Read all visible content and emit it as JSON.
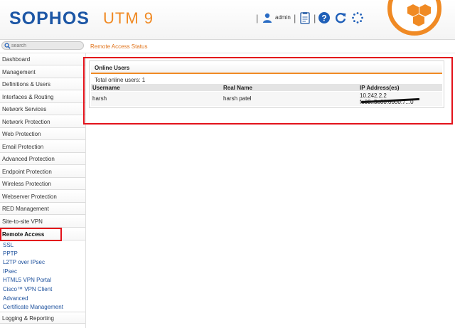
{
  "header": {
    "logo": "SOPHOS",
    "product": "UTM 9",
    "separator": "|",
    "user": "admin"
  },
  "search": {
    "placeholder": "search"
  },
  "breadcrumb": "Remote Access Status",
  "sidebar": {
    "items": [
      {
        "label": "Dashboard"
      },
      {
        "label": "Management"
      },
      {
        "label": "Definitions & Users"
      },
      {
        "label": "Interfaces & Routing"
      },
      {
        "label": "Network Services"
      },
      {
        "label": "Network Protection"
      },
      {
        "label": "Web Protection"
      },
      {
        "label": "Email Protection"
      },
      {
        "label": "Advanced Protection"
      },
      {
        "label": "Endpoint Protection"
      },
      {
        "label": "Wireless Protection"
      },
      {
        "label": "Webserver Protection"
      },
      {
        "label": "RED Management"
      },
      {
        "label": "Site-to-site VPN"
      },
      {
        "label": "Remote Access"
      }
    ],
    "subitems": [
      {
        "label": "SSL"
      },
      {
        "label": "PPTP"
      },
      {
        "label": "L2TP over IPsec"
      },
      {
        "label": "IPsec"
      },
      {
        "label": "HTML5 VPN Portal"
      },
      {
        "label": "Cisco™ VPN Client"
      },
      {
        "label": "Advanced"
      },
      {
        "label": "Certificate Management"
      }
    ],
    "bottom_item": {
      "label": "Logging & Reporting"
    }
  },
  "online_users": {
    "title": "Online Users",
    "total": "Total online users: 1",
    "columns": [
      "Username",
      "Real Name",
      "IP Address(es)"
    ],
    "rows": [
      {
        "username": "harsh",
        "real_name": "harsh patel",
        "ip1": "10.242.2.2",
        "ip2": "fe80::5e00:0000:7...0"
      }
    ]
  },
  "colors": {
    "brand_blue": "#1c56a5",
    "accent_orange": "#f08a24",
    "highlight_red": "#e3121b"
  },
  "icons": [
    "user-icon",
    "clipboard-icon",
    "help-icon",
    "refresh-icon",
    "loading-icon",
    "search-icon"
  ]
}
